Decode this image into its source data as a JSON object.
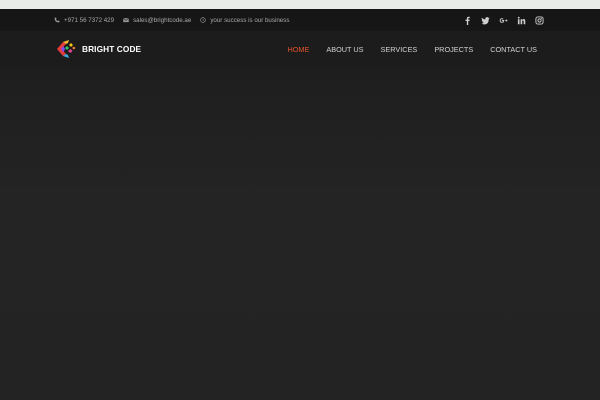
{
  "colors": {
    "accent": "#e5532c",
    "background": "#232323",
    "topbar": "#161616",
    "header": "#1c1c1c"
  },
  "topbar": {
    "phone": {
      "icon": "phone-icon",
      "text": "+971 56 7372 429"
    },
    "email": {
      "icon": "envelope-icon",
      "text": "sales@brightcode.ae"
    },
    "tagline": {
      "icon": "clock-icon",
      "text": "your success is our business"
    },
    "social": [
      "facebook-icon",
      "twitter-icon",
      "google-plus-icon",
      "linkedin-icon",
      "instagram-icon"
    ]
  },
  "header": {
    "logo_text": "BRIGHT CODE",
    "nav": [
      {
        "label": "HOME",
        "active": true
      },
      {
        "label": "ABOUT US",
        "active": false
      },
      {
        "label": "SERVICES",
        "active": false
      },
      {
        "label": "PROJECTS",
        "active": false
      },
      {
        "label": "CONTACT US",
        "active": false
      }
    ]
  }
}
